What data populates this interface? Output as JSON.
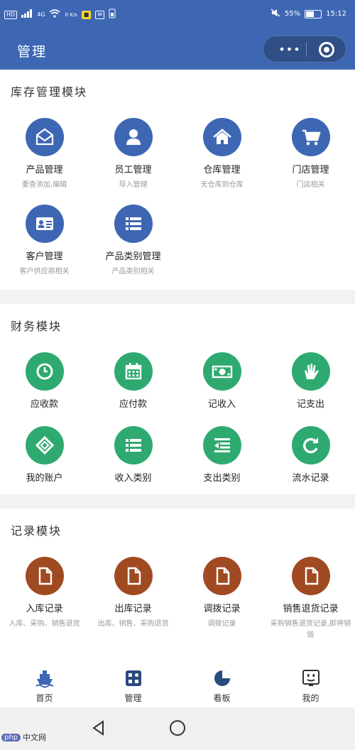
{
  "status_bar": {
    "left_chips": [
      "HD",
      "4G"
    ],
    "speed": "0 K/s",
    "battery_percent": "55%",
    "battery_level": 0.55,
    "time": "15:12"
  },
  "header": {
    "title": "管理"
  },
  "sections": [
    {
      "title": "库存管理模块",
      "items": [
        {
          "label": "产品管理",
          "sub": "要查添加,编辑",
          "icon": "mail-open-icon"
        },
        {
          "label": "员工管理",
          "sub": "导入管理",
          "icon": "user-icon"
        },
        {
          "label": "仓库管理",
          "sub": "无仓库到仓库",
          "icon": "home-icon"
        },
        {
          "label": "门店管理",
          "sub": "门店相关",
          "icon": "cart-icon"
        },
        {
          "label": "客户管理",
          "sub": "客户供应商相关",
          "icon": "id-card-icon"
        },
        {
          "label": "产品类别管理",
          "sub": "产品类别相关",
          "icon": "list-icon"
        }
      ]
    },
    {
      "title": "财务模块",
      "items": [
        {
          "label": "应收款",
          "sub": "",
          "icon": "clock-icon"
        },
        {
          "label": "应付款",
          "sub": "",
          "icon": "calendar-icon"
        },
        {
          "label": "记收入",
          "sub": "",
          "icon": "money-icon"
        },
        {
          "label": "记支出",
          "sub": "",
          "icon": "hand-icon"
        },
        {
          "label": "我的账户",
          "sub": "",
          "icon": "account-icon"
        },
        {
          "label": "收入类别",
          "sub": "",
          "icon": "list-icon"
        },
        {
          "label": "支出类别",
          "sub": "",
          "icon": "indent-icon"
        },
        {
          "label": "流水记录",
          "sub": "",
          "icon": "refresh-icon"
        }
      ]
    },
    {
      "title": "记录模块",
      "items": [
        {
          "label": "入库记录",
          "sub": "入库、采购、销售退货",
          "icon": "file-icon"
        },
        {
          "label": "出库记录",
          "sub": "出库、销售、采购退货",
          "icon": "file-icon"
        },
        {
          "label": "调拨记录",
          "sub": "调拨记录",
          "icon": "file-icon"
        },
        {
          "label": "销售退货记录",
          "sub": "采购销售退货记录,即将销毁",
          "icon": "file-icon"
        }
      ]
    }
  ],
  "tabbar": [
    {
      "label": "首页",
      "icon": "ship-icon"
    },
    {
      "label": "管理",
      "icon": "grid-icon"
    },
    {
      "label": "看板",
      "icon": "pie-chart-icon"
    },
    {
      "label": "我的",
      "icon": "face-icon"
    }
  ],
  "watermark": {
    "logo": "php",
    "text": "中文网"
  },
  "colors": {
    "primary_blue": "#3d67b3",
    "green": "#2eaa71",
    "brown": "#a04a22"
  }
}
